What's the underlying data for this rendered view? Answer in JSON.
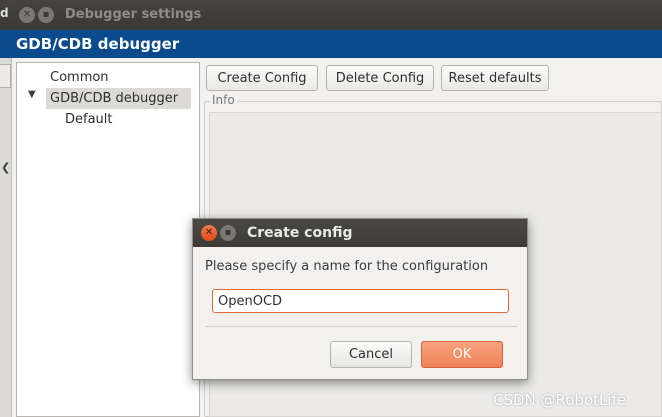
{
  "window": {
    "title_fragment": "d",
    "close_glyph": "✕",
    "minimize_glyph": "▪",
    "title": "Debugger settings"
  },
  "header": {
    "title": "GDB/CDB debugger"
  },
  "left_strip": {
    "icon_glyph": "❮"
  },
  "tree": {
    "expander_glyph": "▼",
    "items": [
      {
        "label": "Common"
      },
      {
        "label": "GDB/CDB debugger",
        "selected": true
      },
      {
        "label": "Default"
      }
    ]
  },
  "toolbar": {
    "create_label": "Create Config",
    "delete_label": "Delete Config",
    "reset_label": "Reset defaults"
  },
  "info": {
    "label": "Info"
  },
  "dialog": {
    "title": "Create config",
    "close_glyph": "✕",
    "minimize_glyph": "▪",
    "prompt": "Please specify a name for the configuration",
    "input_value": "OpenOCD",
    "cancel_label": "Cancel",
    "ok_label": "OK"
  },
  "watermark": "CSDN @RobotLife",
  "colors": {
    "header_blue": "#0b4a8c",
    "accent_orange": "#ef8257",
    "titlebar_dark": "#3c3b37"
  }
}
